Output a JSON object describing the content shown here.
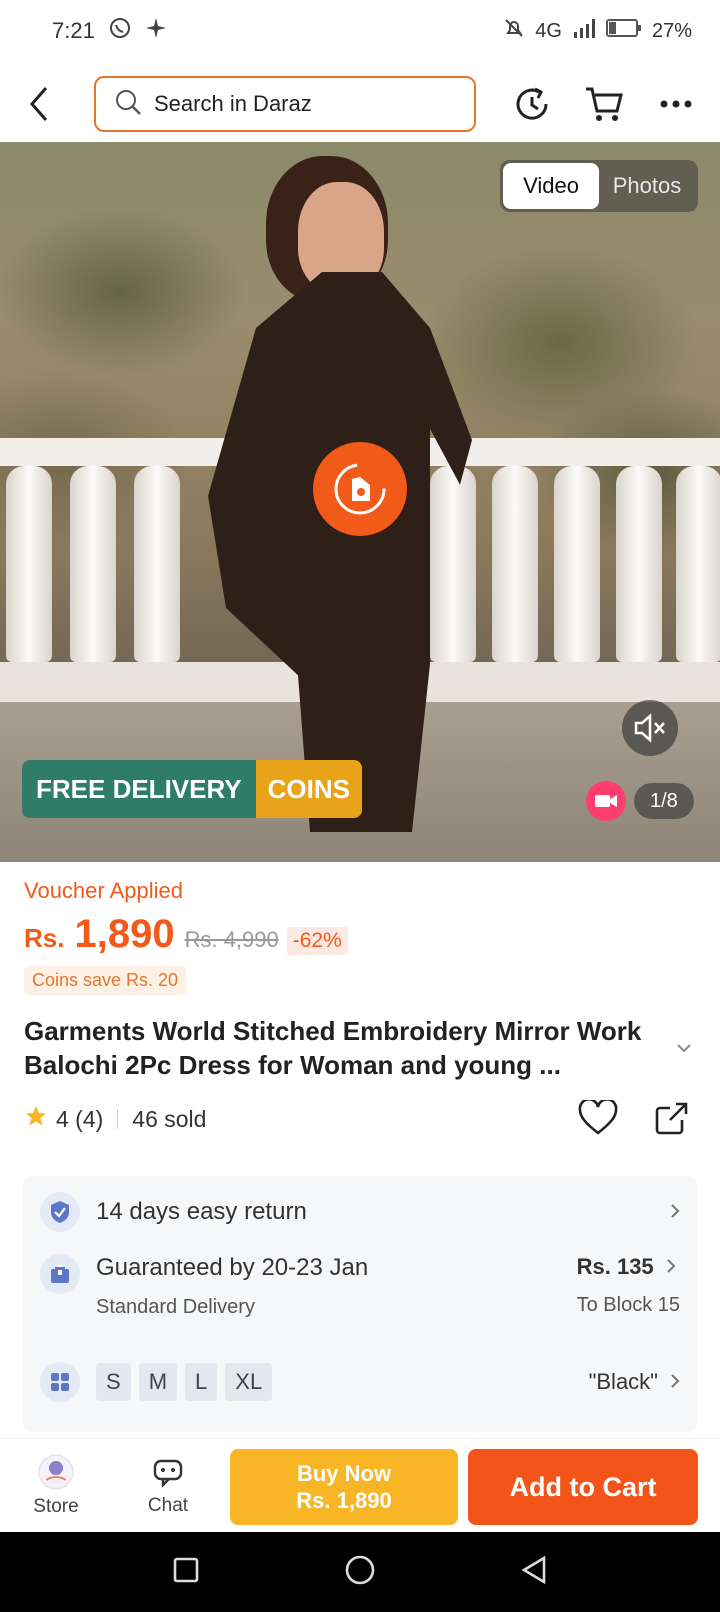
{
  "status": {
    "time": "7:21",
    "network": "4G",
    "battery": "27%",
    "battery_level": 0.27,
    "icons": [
      "whatsapp-icon",
      "sparkle-icon",
      "mute-bell-icon",
      "signal-icon",
      "battery-icon"
    ]
  },
  "header": {
    "search_placeholder": "Search in Daraz",
    "icons": [
      "back-icon",
      "search-icon",
      "history-icon",
      "cart-icon",
      "more-icon"
    ]
  },
  "media": {
    "tab_video": "Video",
    "tab_photos": "Photos",
    "active_tab": "Video",
    "badge_free_delivery": "FREE DELIVERY",
    "badge_coins": "COINS",
    "counter": "1/8"
  },
  "product": {
    "voucher": "Voucher Applied",
    "currency": "Rs.",
    "price": "1,890",
    "original_price": "Rs. 4,990",
    "discount": "-62%",
    "coins_save": "Coins save Rs. 20",
    "title": "Garments World Stitched Embroidery Mirror Work Balochi 2Pc Dress for Woman and young ...",
    "rating": "4 (4)",
    "sold": "46 sold"
  },
  "services": {
    "return_label": "14 days easy return",
    "delivery_label": "Guaranteed by 20-23 Jan",
    "delivery_sub": "Standard Delivery",
    "delivery_price": "Rs. 135",
    "delivery_location": "To Block 15",
    "sizes": [
      "S",
      "M",
      "L",
      "XL"
    ],
    "color": "\"Black\""
  },
  "actions": {
    "store": "Store",
    "chat": "Chat",
    "buy_now": "Buy Now",
    "buy_now_price": "Rs. 1,890",
    "add_to_cart": "Add to Cart"
  },
  "colors": {
    "accent": "#f15a19",
    "buy_now": "#f8b526",
    "add_to_cart": "#f2541a",
    "free_delivery": "#2f7d67",
    "coins": "#e8a319"
  }
}
